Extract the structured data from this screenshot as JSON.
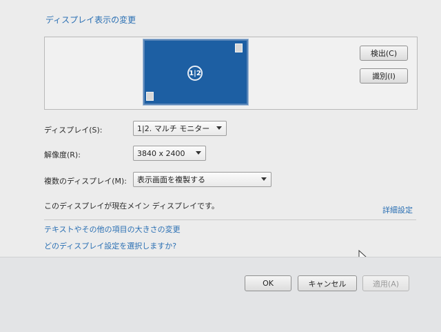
{
  "section_title": "ディスプレイ表示の変更",
  "preview": {
    "monitor_label": "1|2"
  },
  "buttons": {
    "detect": "検出(C)",
    "identify": "識別(I)",
    "ok": "OK",
    "cancel": "キャンセル",
    "apply": "適用(A)"
  },
  "fields": {
    "display": {
      "label": "ディスプレイ(S):",
      "value": "1|2. マルチ モニター"
    },
    "resolution": {
      "label": "解像度(R):",
      "value": "3840 x 2400"
    },
    "multiple": {
      "label": "複数のディスプレイ(M):",
      "value": "表示画面を複製する"
    }
  },
  "main_display_text": "このディスプレイが現在メイン ディスプレイです。",
  "links": {
    "advanced": "詳細設定",
    "text_size": "テキストやその他の項目の大きさの変更",
    "which_settings": "どのディスプレイ設定を選択しますか?"
  },
  "colors": {
    "link": "#2a6fb3",
    "monitor": "#1d5fa3"
  }
}
